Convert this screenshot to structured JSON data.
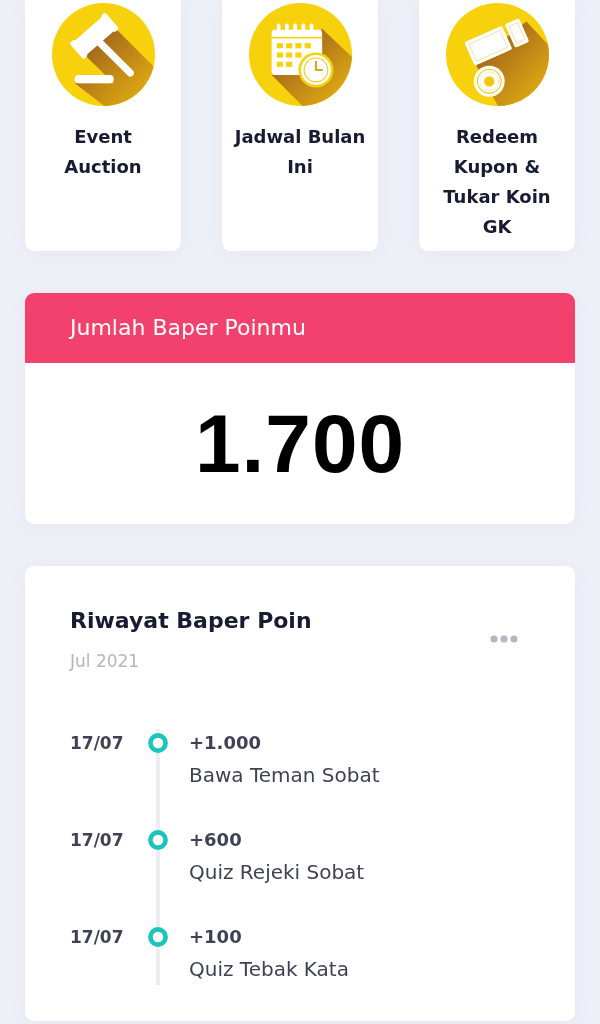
{
  "shortcuts": [
    {
      "kind": "gavel",
      "label": "Event Auction"
    },
    {
      "kind": "calendar",
      "label": "Jadwal Bulan Ini"
    },
    {
      "kind": "tickets",
      "label": "Redeem Kupon & Tukar Koin GK"
    }
  ],
  "points": {
    "title": "Jumlah Baper Poinmu",
    "value": "1.700"
  },
  "history": {
    "title": "Riwayat Baper Poin",
    "period": "Jul 2021",
    "entries": [
      {
        "date": "17/07",
        "amount": "+1.000",
        "description": "Bawa Teman Sobat"
      },
      {
        "date": "17/07",
        "amount": "+600",
        "description": "Quiz Rejeki Sobat"
      },
      {
        "date": "17/07",
        "amount": "+100",
        "description": "Quiz Tebak Kata"
      }
    ]
  }
}
